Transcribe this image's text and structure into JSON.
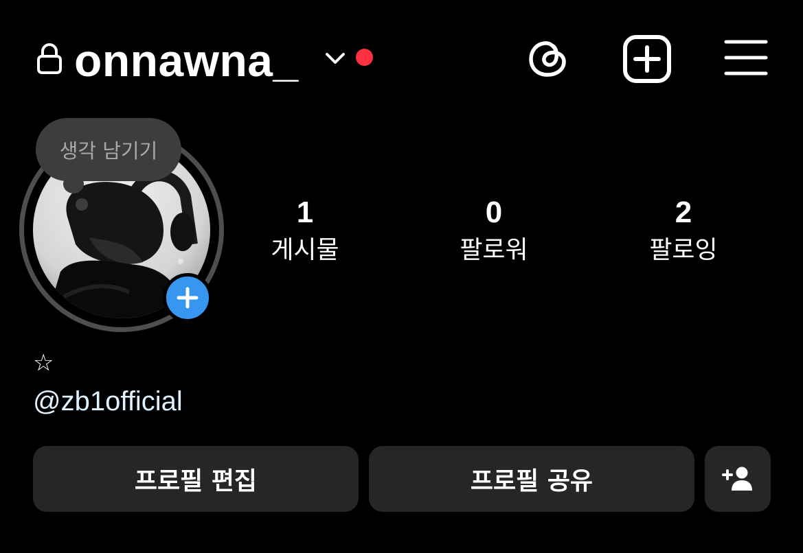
{
  "header": {
    "username": "onnawna_",
    "icons": {
      "lock": "lock-icon",
      "dropdown": "chevron-down-icon",
      "threads": "threads-icon",
      "new_post": "plus-square-icon",
      "menu": "hamburger-menu-icon"
    },
    "notification_dot_color": "#ff3040"
  },
  "profile": {
    "note_placeholder": "생각 남기기",
    "avatar_ring_color": "#4e4e4e",
    "add_story_color": "#3797f0",
    "stats": [
      {
        "value": "1",
        "label": "게시물"
      },
      {
        "value": "0",
        "label": "팔로워"
      },
      {
        "value": "2",
        "label": "팔로잉"
      }
    ],
    "bio": {
      "line1": "☆",
      "mention": "@zb1official"
    }
  },
  "actions": {
    "edit_profile": "프로필 편집",
    "share_profile": "프로필 공유",
    "suggest_icon": "add-person-icon"
  },
  "colors": {
    "background": "#000000",
    "button_bg": "#262626",
    "text": "#ffffff",
    "link": "#e0f1ff"
  }
}
